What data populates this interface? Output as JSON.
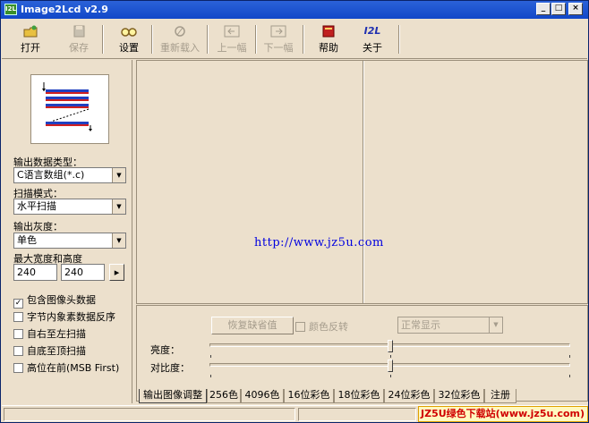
{
  "window": {
    "title": "Image2Lcd v2.9",
    "icon_text": "I2L",
    "controls": {
      "minimize": "_",
      "maximize": "□",
      "close": "×"
    }
  },
  "toolbar": {
    "items": [
      {
        "label": "打开",
        "icon": "open-folder-icon",
        "enabled": true
      },
      {
        "label": "保存",
        "icon": "save-disk-icon",
        "enabled": false
      },
      {
        "label": "设置",
        "icon": "glasses-icon",
        "enabled": true
      },
      {
        "label": "重新载入",
        "icon": "reload-icon",
        "enabled": false
      },
      {
        "label": "上一幅",
        "icon": "prev-arrow-icon",
        "enabled": false
      },
      {
        "label": "下一幅",
        "icon": "next-arrow-icon",
        "enabled": false
      },
      {
        "label": "帮助",
        "icon": "help-book-icon",
        "enabled": true
      },
      {
        "label": "关于",
        "icon": "about-i2l-icon",
        "enabled": true
      }
    ],
    "about_icon_text": "I2L"
  },
  "left": {
    "output_type_label": "输出数据类型：",
    "output_type_value": "C语言数组(*.c)",
    "scan_mode_label": "扫描模式：",
    "scan_mode_value": "水平扫描",
    "gray_label": "输出灰度：",
    "gray_value": "单色",
    "size_label": "最大宽度和高度",
    "max_width": "240",
    "max_height": "240",
    "size_button": "▸",
    "checkboxes": [
      {
        "label": "包含图像头数据",
        "checked": true
      },
      {
        "label": "字节内象素数据反序",
        "checked": false
      },
      {
        "label": "自右至左扫描",
        "checked": false
      },
      {
        "label": "自底至顶扫描",
        "checked": false
      },
      {
        "label": "高位在前(MSB First)",
        "checked": false
      }
    ]
  },
  "canvas": {
    "url_text": "http://www.jz5u.com"
  },
  "controls": {
    "restore_button": "恢复缺省值",
    "invert_label": "颜色反转",
    "display_mode": "正常显示",
    "brightness_label": "亮度：",
    "contrast_label": "对比度：",
    "brightness_value": 0.5,
    "contrast_value": 0.5
  },
  "tabs": [
    "输出图像调整",
    "256色",
    "4096色",
    "16位彩色",
    "18位彩色",
    "24位彩色",
    "32位彩色",
    "注册"
  ],
  "watermark": "JZ5U绿色下载站(www.jz5u.com)",
  "colors": {
    "titlebar": "#1147c8",
    "face": "#ece0cc",
    "url": "#0000e0"
  }
}
